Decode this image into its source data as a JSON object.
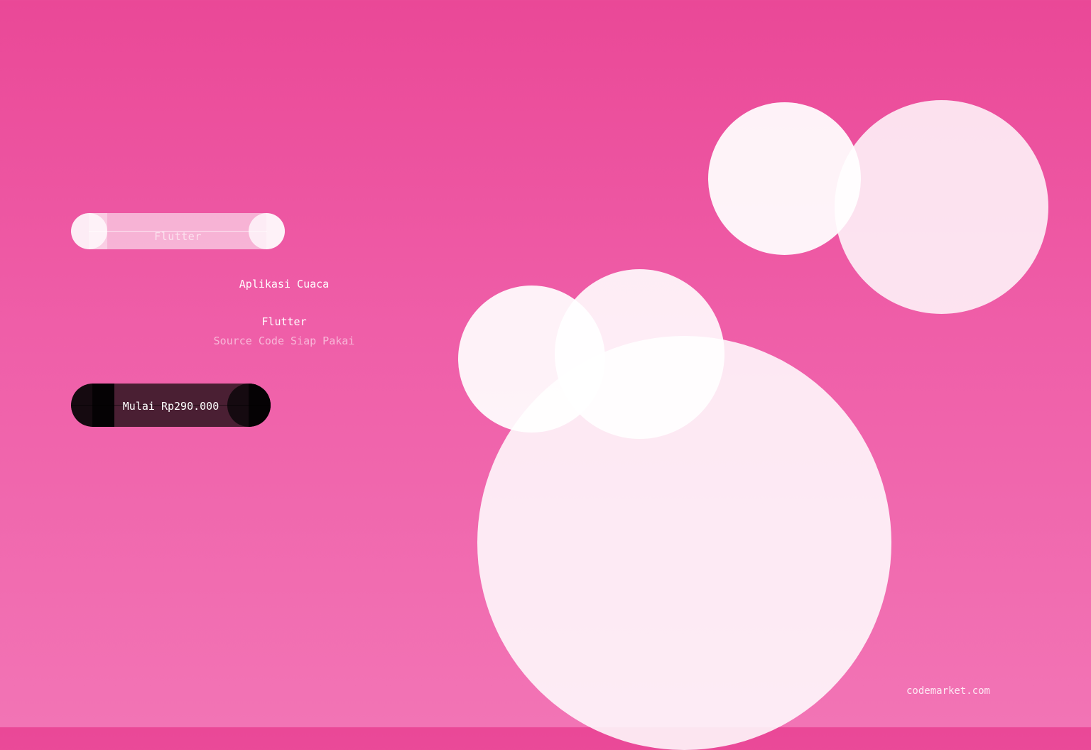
{
  "tag": {
    "label": "Flutter"
  },
  "hero": {
    "title": "Aplikasi Cuaca",
    "subtitle": "Flutter",
    "caption": "Source Code Siap Pakai"
  },
  "cta": {
    "label": "Mulai Rp290.000"
  },
  "footer": {
    "site": "codemarket.com"
  },
  "colors": {
    "background_top": "#ea4897",
    "background_bottom": "#f274b5",
    "cta_background": "#4a1f33",
    "text": "#ffffff"
  }
}
